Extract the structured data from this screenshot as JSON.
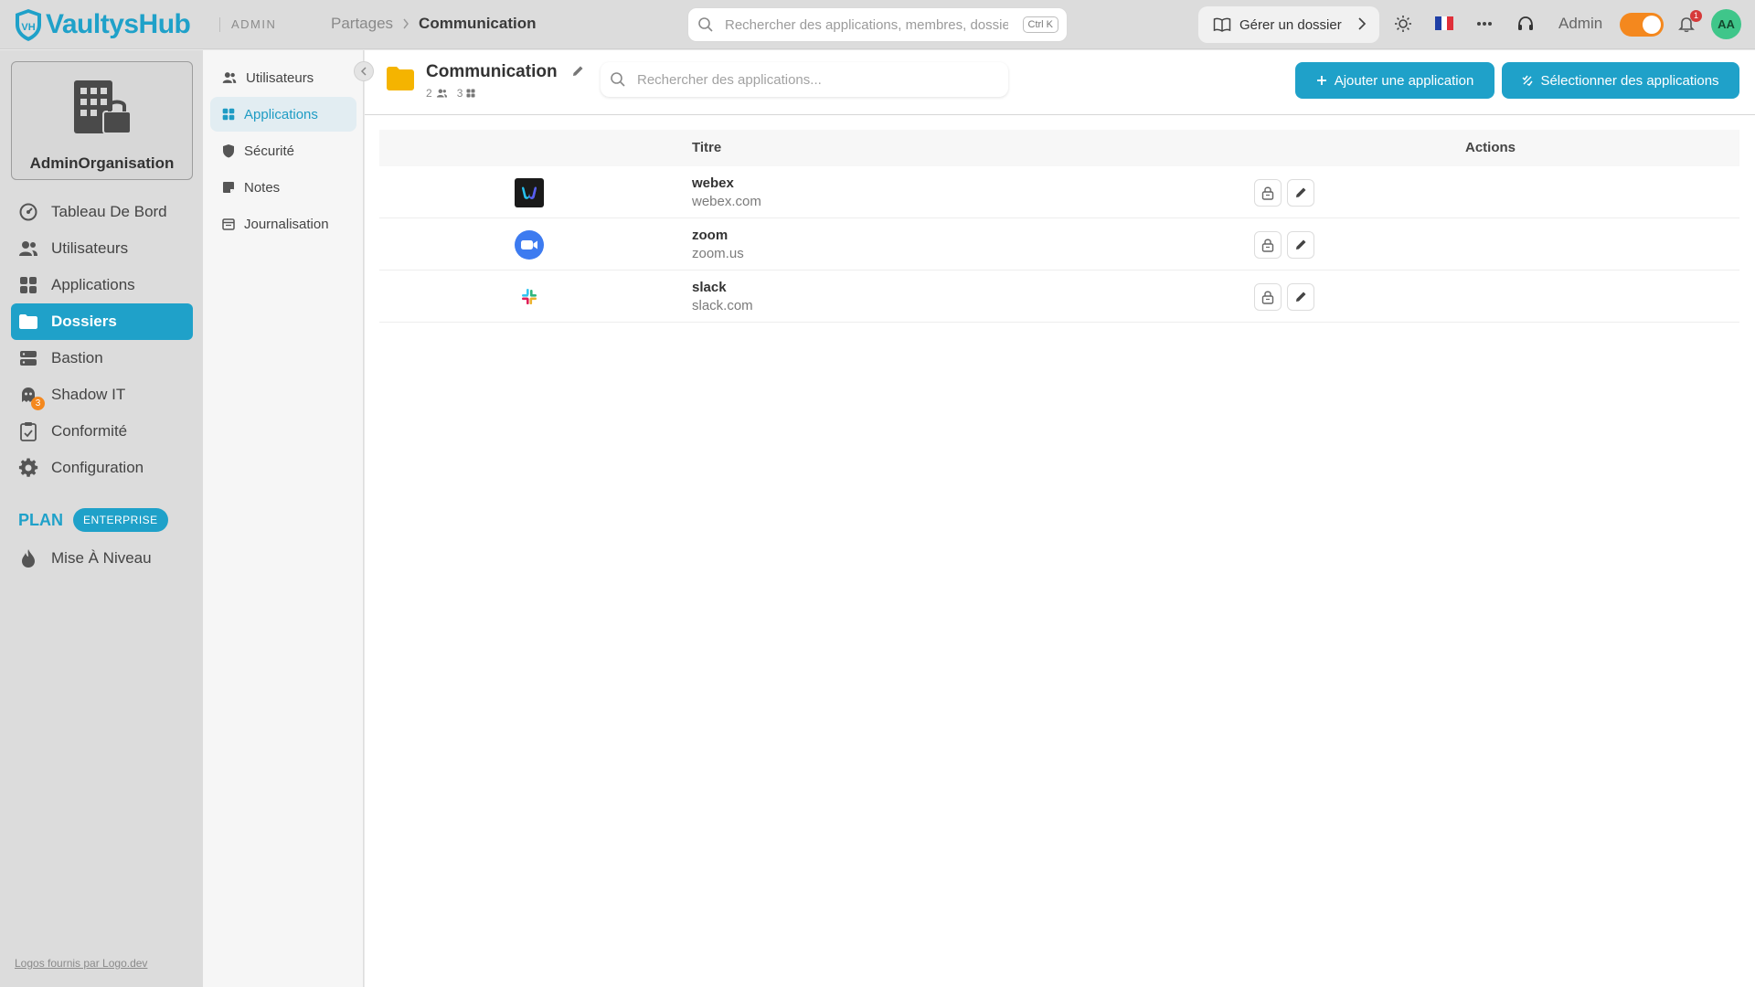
{
  "topbar": {
    "brand": "VaultysHub",
    "admin_tag": "ADMIN",
    "breadcrumb": {
      "parent": "Partages",
      "current": "Communication"
    },
    "search": {
      "placeholder": "Rechercher des applications, membres, dossiers...",
      "shortcut": "Ctrl K"
    },
    "manage_folder_label": "Gérer un dossier",
    "user_label": "Admin",
    "notifications_count": "1",
    "avatar_initials": "AA",
    "icons": [
      "book-icon",
      "sun-icon",
      "flag-fr-icon",
      "more-icon",
      "support-icon",
      "bell-icon"
    ]
  },
  "sidebar": {
    "org_name": "AdminOrganisation",
    "items": [
      {
        "label": "Tableau De Bord",
        "icon": "dashboard-icon"
      },
      {
        "label": "Utilisateurs",
        "icon": "users-icon"
      },
      {
        "label": "Applications",
        "icon": "apps-icon"
      },
      {
        "label": "Dossiers",
        "icon": "folder-icon",
        "active": true
      },
      {
        "label": "Bastion",
        "icon": "server-icon"
      },
      {
        "label": "Shadow IT",
        "icon": "ghost-icon",
        "badge": "3"
      },
      {
        "label": "Conformité",
        "icon": "clipboard-icon"
      },
      {
        "label": "Configuration",
        "icon": "gear-icon"
      }
    ],
    "plan_label": "PLAN",
    "plan_badge": "ENTERPRISE",
    "upgrade_label": "Mise À Niveau",
    "footer_link": "Logos fournis par Logo.dev"
  },
  "subnav": {
    "items": [
      {
        "label": "Utilisateurs",
        "icon": "users-icon"
      },
      {
        "label": "Applications",
        "icon": "apps-icon",
        "active": true
      },
      {
        "label": "Sécurité",
        "icon": "shield-icon"
      },
      {
        "label": "Notes",
        "icon": "note-icon"
      },
      {
        "label": "Journalisation",
        "icon": "calendar-icon"
      }
    ]
  },
  "main": {
    "folder_title": "Communication",
    "members_count": "2",
    "apps_count": "3",
    "search_placeholder": "Rechercher des applications...",
    "add_button": "Ajouter une application",
    "select_button": "Sélectionner des applications",
    "table": {
      "headers": {
        "title": "Titre",
        "actions": "Actions"
      },
      "rows": [
        {
          "name": "webex",
          "domain": "webex.com",
          "logo": "webex-logo"
        },
        {
          "name": "zoom",
          "domain": "zoom.us",
          "logo": "zoom-logo"
        },
        {
          "name": "slack",
          "domain": "slack.com",
          "logo": "slack-logo"
        }
      ]
    }
  },
  "colors": {
    "accent": "#1fa1c9",
    "toggle": "#f4881e",
    "avatar": "#3fc68a",
    "folder": "#f5b400",
    "badge_red": "#d63a3a"
  }
}
